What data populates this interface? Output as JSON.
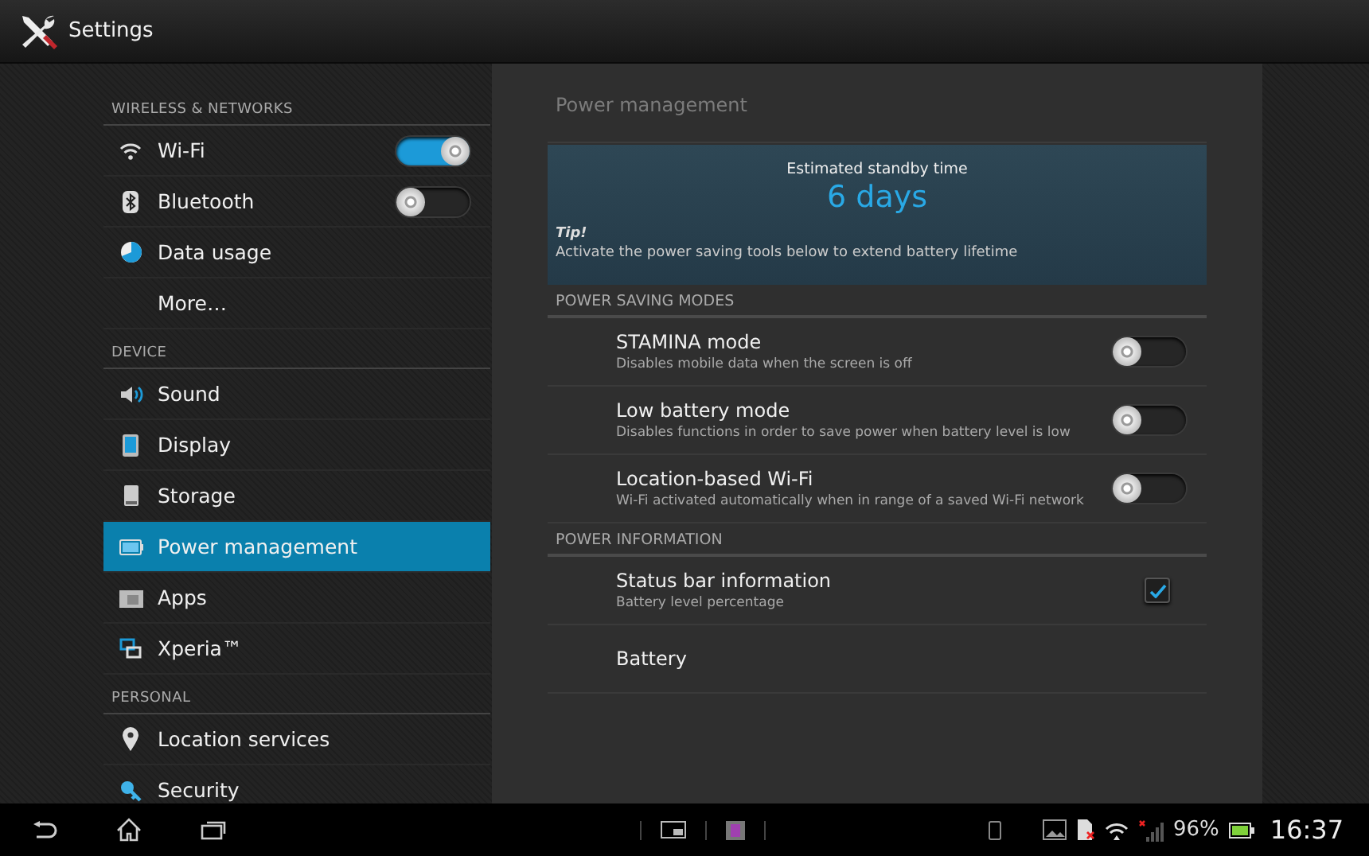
{
  "window": {
    "title": "Settings"
  },
  "sidebar": {
    "sections": [
      {
        "header": "WIRELESS & NETWORKS",
        "items": [
          {
            "label": "Wi-Fi",
            "kind": "toggle",
            "on": true,
            "selected": false
          },
          {
            "label": "Bluetooth",
            "kind": "toggle",
            "on": false,
            "selected": false
          },
          {
            "label": "Data usage",
            "kind": "link",
            "selected": false
          },
          {
            "label": "More…",
            "kind": "link",
            "selected": false
          }
        ]
      },
      {
        "header": "DEVICE",
        "items": [
          {
            "label": "Sound",
            "kind": "link",
            "selected": false
          },
          {
            "label": "Display",
            "kind": "link",
            "selected": false
          },
          {
            "label": "Storage",
            "kind": "link",
            "selected": false
          },
          {
            "label": "Power management",
            "kind": "link",
            "selected": true
          },
          {
            "label": "Apps",
            "kind": "link",
            "selected": false
          },
          {
            "label": "Xperia™",
            "kind": "link",
            "selected": false
          }
        ]
      },
      {
        "header": "PERSONAL",
        "items": [
          {
            "label": "Location services",
            "kind": "link",
            "selected": false
          },
          {
            "label": "Security",
            "kind": "link",
            "selected": false
          }
        ]
      }
    ]
  },
  "panel": {
    "title": "Power management",
    "standby": {
      "label": "Estimated standby time",
      "value": "6 days",
      "tip_title": "Tip!",
      "tip": "Activate the power saving tools below to extend battery lifetime"
    },
    "sections": [
      {
        "header": "POWER SAVING MODES",
        "items": [
          {
            "title": "STAMINA mode",
            "summary": "Disables mobile data when the screen is off",
            "kind": "toggle",
            "on": false
          },
          {
            "title": "Low battery mode",
            "summary": "Disables functions in order to save power when battery level is low",
            "kind": "toggle",
            "on": false
          },
          {
            "title": "Location-based Wi-Fi",
            "summary": "Wi-Fi activated automatically when in range of a saved Wi-Fi network",
            "kind": "toggle",
            "on": false
          }
        ]
      },
      {
        "header": "POWER INFORMATION",
        "items": [
          {
            "title": "Status bar information",
            "summary": "Battery level percentage",
            "kind": "checkbox",
            "checked": true
          },
          {
            "title": "Battery",
            "kind": "link"
          }
        ]
      }
    ]
  },
  "status_bar": {
    "battery_percent": "96%",
    "time": "16:37"
  }
}
